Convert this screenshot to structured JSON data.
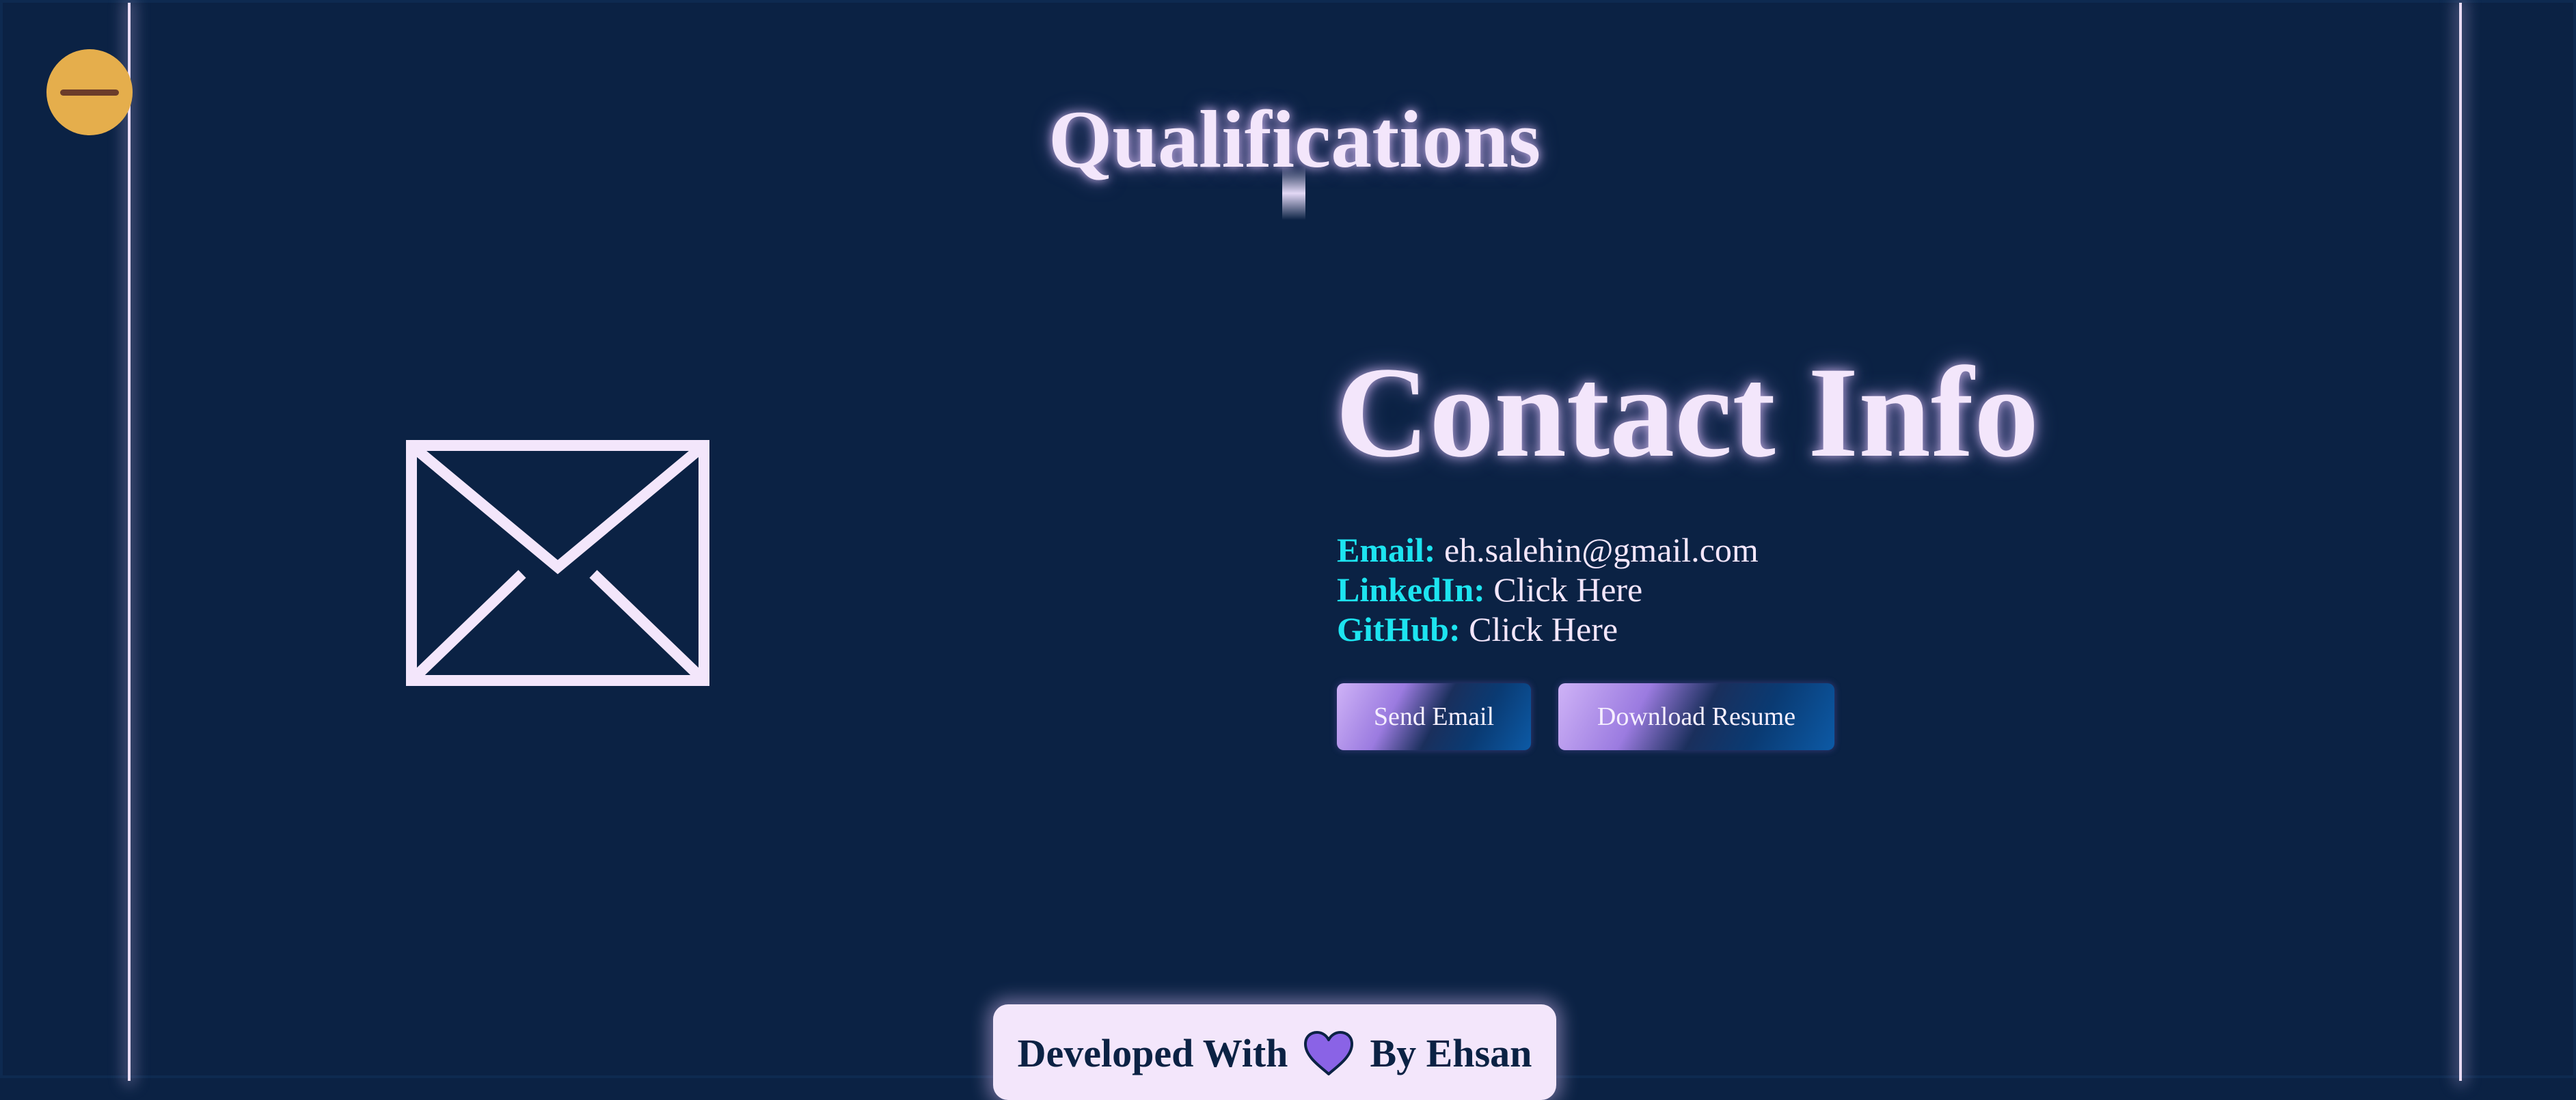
{
  "header": {
    "section_title": "Qualifications"
  },
  "contact": {
    "heading": "Contact Info",
    "email_label": "Email:",
    "email_value": "eh.salehin@gmail.com",
    "linkedin_label": "LinkedIn:",
    "linkedin_value": "Click Here",
    "github_label": "GitHub:",
    "github_value": "Click Here",
    "send_email_label": "Send Email",
    "download_resume_label": "Download Resume"
  },
  "footer": {
    "prefix": "Developed With",
    "suffix": "By Ehsan"
  },
  "icons": {
    "menu": "minus-icon",
    "mail": "mail-envelope-icon",
    "heart": "heart-icon"
  },
  "colors": {
    "background": "#0b2244",
    "accent_text": "#f3e6fb",
    "label_cyan": "#1de4f0",
    "menu_button": "#e5ae4c",
    "heart": "#8a63e6"
  }
}
